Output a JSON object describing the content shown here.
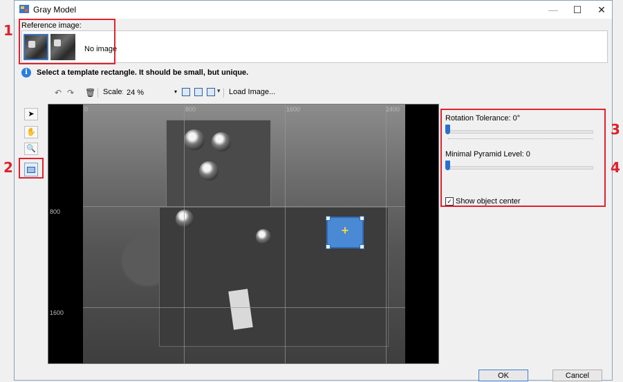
{
  "window": {
    "title": "Gray Model",
    "minimize": "—",
    "maximize": "☐",
    "close": "✕"
  },
  "reference": {
    "label": "Reference image:",
    "no_image": "No image"
  },
  "info": {
    "icon": "i",
    "text": "Select a template rectangle. It should be small, but unique."
  },
  "toolbar": {
    "undo": "↶",
    "redo": "↷",
    "delete": "🗑",
    "scale_label": "Scale:",
    "scale_value": "24 %",
    "scale_arrow": "▾",
    "load_image": "Load Image..."
  },
  "side_tools": {
    "pointer": "➤",
    "hand": "✋",
    "zoom": "🔍"
  },
  "canvas": {
    "axis_top": [
      "0",
      "800",
      "1600",
      "2400"
    ],
    "axis_left": [
      "800",
      "1600"
    ],
    "plus": "+"
  },
  "params": {
    "rotation_label": "Rotation Tolerance: 0°",
    "rotation_value": 0,
    "pyramid_label": "Minimal Pyramid Level: 0",
    "pyramid_value": 0,
    "show_center_label": "Show object center",
    "show_center_checked": true,
    "check_mark": "✓"
  },
  "buttons": {
    "ok": "OK",
    "cancel": "Cancel"
  },
  "annotations": [
    "1",
    "2",
    "3",
    "4"
  ],
  "colors": {
    "annotation": "#e0212b",
    "template": "#4c90e0",
    "accent": "#2a6fd0"
  }
}
